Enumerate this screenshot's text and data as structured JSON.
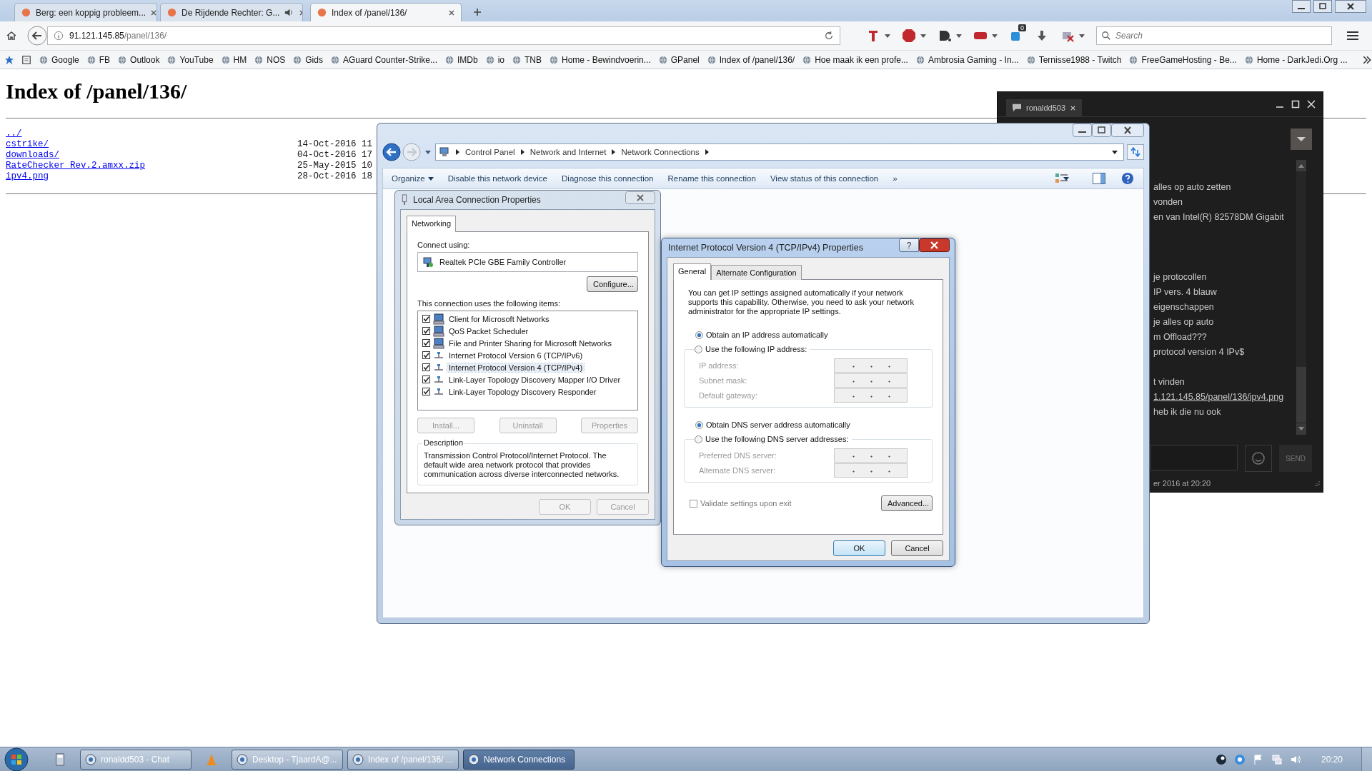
{
  "browser": {
    "tabs": [
      {
        "title": "Berg: een koppig probleem...",
        "selected": false,
        "audio": false
      },
      {
        "title": "De Rijdende Rechter: G...",
        "selected": false,
        "audio": true
      },
      {
        "title": "Index of /panel/136/",
        "selected": true,
        "audio": false
      }
    ],
    "url_host": "91.121.145.85",
    "url_path": "/panel/136/",
    "notification_count": "0",
    "search_placeholder": "Search",
    "bookmarks": [
      "Google",
      "FB",
      "Outlook",
      "YouTube",
      "HM",
      "NOS",
      "Gids",
      "AGuard Counter-Strike...",
      "IMDb",
      "io",
      "TNB",
      "Home - Bewindvoerin...",
      "GPanel",
      "Index of /panel/136/",
      "Hoe maak ik een profe...",
      "Ambrosia Gaming - In...",
      "Ternisse1988 - Twitch",
      "FreeGameHosting - Be...",
      "Home - DarkJedi.Org ..."
    ]
  },
  "page": {
    "heading": "Index of /panel/136/",
    "entries": [
      {
        "name": "../"
      },
      {
        "name": "cstrike/",
        "date": "14-Oct-2016 11"
      },
      {
        "name": "downloads/",
        "date": "04-Oct-2016 17"
      },
      {
        "name": "RateChecker Rev.2.amxx.zip",
        "date": "25-May-2015 10"
      },
      {
        "name": "ipv4.png",
        "date": "28-Oct-2016 18"
      }
    ]
  },
  "network_window": {
    "breadcrumb": [
      "Control Panel",
      "Network and Internet",
      "Network Connections"
    ],
    "toolbar": [
      "Organize",
      "Disable this network device",
      "Diagnose this connection",
      "Rename this connection",
      "View status of this connection"
    ],
    "more": "»"
  },
  "lan_dialog": {
    "title": "Local Area Connection Properties",
    "tabs": [
      {
        "label": "Networking",
        "selected": true
      }
    ],
    "connect_using_label": "Connect using:",
    "adapter": "Realtek PCIe GBE Family Controller",
    "configure_button": "Configure...",
    "items_label": "This connection uses the following items:",
    "items": [
      {
        "label": "Client for Microsoft Networks",
        "checked": true,
        "selected": false,
        "kind": "computer"
      },
      {
        "label": "QoS Packet Scheduler",
        "checked": true,
        "selected": false,
        "kind": "computer"
      },
      {
        "label": "File and Printer Sharing for Microsoft Networks",
        "checked": true,
        "selected": false,
        "kind": "computer"
      },
      {
        "label": "Internet Protocol Version 6 (TCP/IPv6)",
        "checked": true,
        "selected": false,
        "kind": "protocol"
      },
      {
        "label": "Internet Protocol Version 4 (TCP/IPv4)",
        "checked": true,
        "selected": true,
        "kind": "protocol"
      },
      {
        "label": "Link-Layer Topology Discovery Mapper I/O Driver",
        "checked": true,
        "selected": false,
        "kind": "protocol"
      },
      {
        "label": "Link-Layer Topology Discovery Responder",
        "checked": true,
        "selected": false,
        "kind": "protocol"
      }
    ],
    "item_buttons": [
      {
        "label": "Install...",
        "disabled": true
      },
      {
        "label": "Uninstall",
        "disabled": true
      },
      {
        "label": "Properties",
        "disabled": true
      }
    ],
    "description_label": "Description",
    "description": "Transmission Control Protocol/Internet Protocol. The default wide area network protocol that provides communication across diverse interconnected networks.",
    "footer_buttons": [
      {
        "label": "OK",
        "disabled": true
      },
      {
        "label": "Cancel",
        "disabled": true
      }
    ]
  },
  "ipv4_dialog": {
    "title": "Internet Protocol Version 4 (TCP/IPv4) Properties",
    "help_button": "?",
    "tabs": [
      {
        "label": "General",
        "selected": true
      },
      {
        "label": "Alternate Configuration",
        "selected": false
      }
    ],
    "intro": "You can get IP settings assigned automatically if your network supports this capability. Otherwise, you need to ask your network administrator for the appropriate IP settings.",
    "ip_options": [
      {
        "label": "Obtain an IP address automatically",
        "selected": true
      },
      {
        "label": "Use the following IP address:",
        "selected": false
      }
    ],
    "ip_fields": [
      {
        "label": "IP address:",
        "disabled": true
      },
      {
        "label": "Subnet mask:",
        "disabled": true
      },
      {
        "label": "Default gateway:",
        "disabled": true
      }
    ],
    "dns_options": [
      {
        "label": "Obtain DNS server address automatically",
        "selected": true
      },
      {
        "label": "Use the following DNS server addresses:",
        "selected": false
      }
    ],
    "dns_fields": [
      {
        "label": "Preferred DNS server:",
        "disabled": true
      },
      {
        "label": "Alternate DNS server:",
        "disabled": true
      }
    ],
    "validate": {
      "label": "Validate settings upon exit",
      "checked": false,
      "disabled": true
    },
    "advanced_button": "Advanced...",
    "ok_button": "OK",
    "cancel_button": "Cancel"
  },
  "chat": {
    "tab": "ronaldd503",
    "message_groups": [
      [
        {
          "text": "alles op auto zetten",
          "kind": "text"
        },
        {
          "text": "vonden",
          "kind": "text"
        },
        {
          "text": "en van Intel(R) 82578DM Gigabit",
          "kind": "text"
        }
      ],
      [
        {
          "text": "je protocollen",
          "kind": "text"
        },
        {
          "text": "IP vers. 4 blauw",
          "kind": "text"
        },
        {
          "text": "eigenschappen",
          "kind": "text"
        },
        {
          "text": "je alles op auto",
          "kind": "text"
        },
        {
          "text": "m Offload???",
          "kind": "text"
        },
        {
          "text": "protocol version 4 IPv$",
          "kind": "text"
        }
      ],
      [
        {
          "text": "t vinden",
          "kind": "text"
        },
        {
          "text": "1.121.145.85/panel/136/ipv4.png",
          "kind": "link"
        },
        {
          "text": "heb ik die nu ook",
          "kind": "text"
        }
      ]
    ],
    "send_button": "SEND",
    "timestamp": "er 2016 at 20:20"
  },
  "taskbar": {
    "items": [
      {
        "label": "ronaldd503 - Chat",
        "selected": false
      },
      {
        "label": "Desktop - TjaardA@...",
        "selected": false
      },
      {
        "label": "Index of /panel/136/ ...",
        "selected": false
      },
      {
        "label": "Network Connections",
        "selected": true
      }
    ],
    "clock": "20:20"
  }
}
